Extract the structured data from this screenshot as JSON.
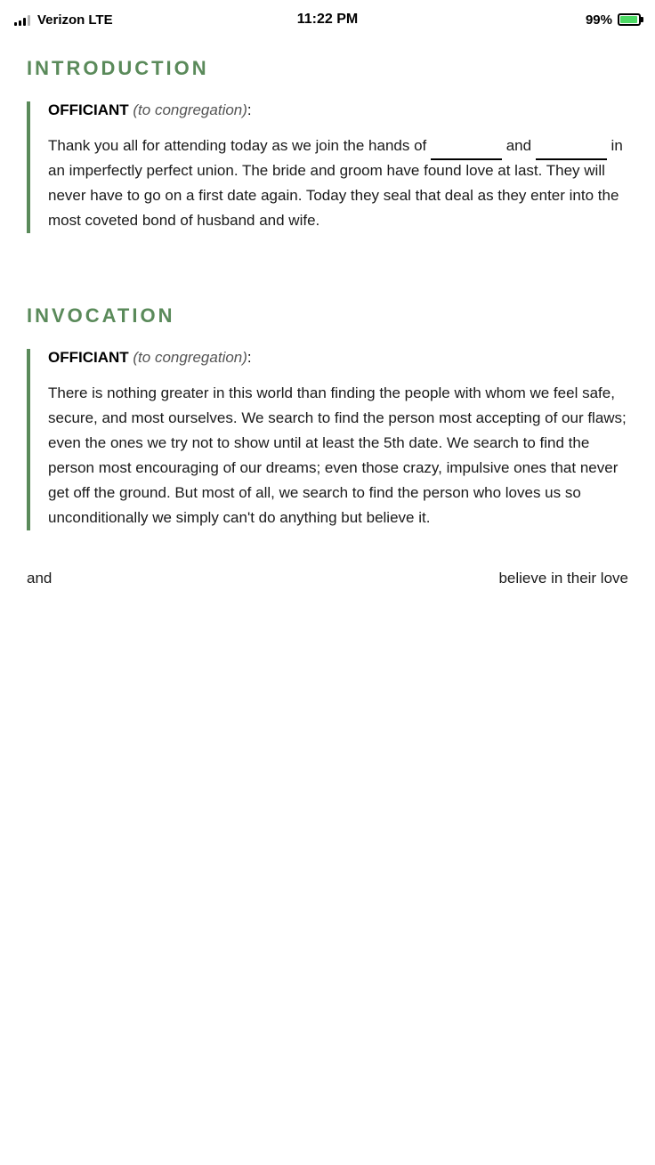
{
  "statusBar": {
    "carrier": "Verizon",
    "network": "LTE",
    "time": "11:22 PM",
    "battery": "99%",
    "batteryCharging": true
  },
  "sections": [
    {
      "id": "introduction",
      "heading": "INTRODUCTION",
      "blocks": [
        {
          "speaker": "OFFICIANT",
          "direction": "(to congregation)",
          "colon": ":",
          "paragraphs": [
            "Thank you all for attending today as we join the hands of __________ and __________ in an imperfectly perfect union. The bride and groom have found love at last. They will never have to go on a first date again. Today they seal that deal as they enter into the most coveted bond of husband and wife."
          ]
        }
      ]
    },
    {
      "id": "invocation",
      "heading": "INVOCATION",
      "blocks": [
        {
          "speaker": "OFFICIANT",
          "direction": "(to congregation)",
          "colon": ":",
          "paragraphs": [
            "There is nothing greater in this world than finding the people with whom we feel safe, secure, and most ourselves. We search to find the person most accepting of our flaws; even the ones we try not to show until at least the 5th date. We search to find the person most encouraging of our dreams; even those crazy, impulsive ones that never get off the ground. But most of all, we search to find the person who loves us so unconditionally we simply can't do anything but believe it."
          ]
        }
      ]
    }
  ],
  "partialBottom": {
    "left": "and",
    "right": "believe in their love"
  }
}
